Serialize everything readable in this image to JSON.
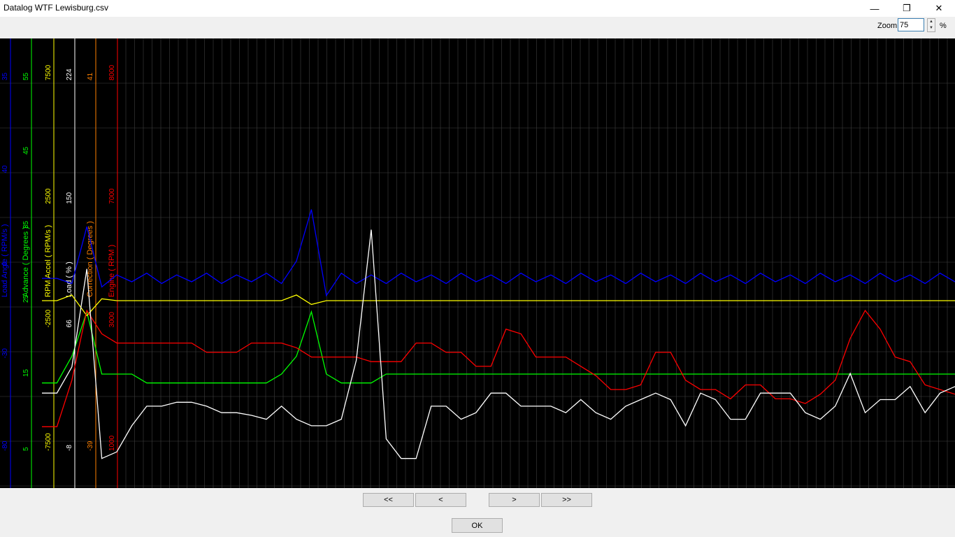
{
  "window": {
    "title": "Datalog WTF Lewisburg.csv",
    "minimize_glyph": "—",
    "restore_glyph": "❐",
    "close_glyph": "✕"
  },
  "zoom": {
    "label": "Zoom",
    "value": "75",
    "unit": "%"
  },
  "nav": {
    "first": "<<",
    "prev": "<",
    "next": ">",
    "last": ">>"
  },
  "ok_label": "OK",
  "colors": {
    "plot_bg": "#000000",
    "grid": "#404040",
    "load_angle": "#0000ff",
    "advance": "#00ff00",
    "rpm_accel": "#ffff00",
    "load": "#ffffff",
    "correction": "#ff8000",
    "engine_rpm": "#ff0000"
  },
  "chart_data": {
    "type": "line",
    "axes": [
      {
        "name": "Load Angle ( RPM/s )",
        "color": "#0000ff",
        "ticks": [
          "35",
          "40",
          "0",
          "-30",
          "-80"
        ]
      },
      {
        "name": "Advance ( Degrees )",
        "color": "#00ff00",
        "ticks": [
          "55",
          "45",
          "35",
          "25",
          "15",
          "5"
        ]
      },
      {
        "name": "RPM Accel ( RPM/s )",
        "color": "#ffff00",
        "ticks": [
          "7500",
          "2500",
          "-2500",
          "-7500"
        ]
      },
      {
        "name": "Load ( % )",
        "color": "#ffffff",
        "ticks": [
          "224",
          "150",
          "66",
          "-8"
        ]
      },
      {
        "name": "Correction ( Degrees )",
        "color": "#ff8000",
        "ticks": [
          "41",
          "-39"
        ]
      },
      {
        "name": "Engine ( RPM )",
        "color": "#ff0000",
        "ticks": [
          "8000",
          "7000",
          "3000",
          "1000"
        ]
      }
    ],
    "series": [
      {
        "name": "Engine ( RPM )",
        "values": [
          1500,
          1500,
          2500,
          4000,
          3500,
          3300,
          3300,
          3300,
          3300,
          3300,
          3300,
          3100,
          3100,
          3100,
          3300,
          3300,
          3300,
          3200,
          3000,
          3000,
          3000,
          3000,
          2900,
          2900,
          2900,
          3300,
          3300,
          3100,
          3100,
          2800,
          2800,
          3600,
          3500,
          3000,
          3000,
          3000,
          2800,
          2600,
          2300,
          2300,
          2400,
          3100,
          3100,
          2500,
          2300,
          2300,
          2100,
          2400,
          2400,
          2100,
          2100,
          2000,
          2200,
          2500,
          3400,
          4000,
          3600,
          3000,
          2900,
          2400,
          2300,
          2200
        ]
      },
      {
        "name": "Load ( % )",
        "values": [
          55,
          55,
          75,
          150,
          5,
          10,
          30,
          45,
          45,
          48,
          48,
          45,
          40,
          40,
          38,
          35,
          45,
          35,
          30,
          30,
          35,
          80,
          180,
          20,
          5,
          5,
          45,
          45,
          35,
          40,
          55,
          55,
          45,
          45,
          45,
          40,
          50,
          40,
          35,
          45,
          50,
          55,
          50,
          30,
          55,
          50,
          35,
          35,
          55,
          55,
          55,
          40,
          35,
          45,
          70,
          40,
          50,
          50,
          60,
          40,
          55,
          60
        ]
      },
      {
        "name": "Advance ( Degrees )",
        "values": [
          14,
          14,
          20,
          30,
          16,
          16,
          16,
          14,
          14,
          14,
          14,
          14,
          14,
          14,
          14,
          14,
          16,
          20,
          30,
          16,
          14,
          14,
          14,
          16,
          16,
          16,
          16,
          16,
          16,
          16,
          16,
          16,
          16,
          16,
          16,
          16,
          16,
          16,
          16,
          16,
          16,
          16,
          16,
          16,
          16,
          16,
          16,
          16,
          16,
          16,
          16,
          16,
          16,
          16,
          16,
          16,
          16,
          16,
          16,
          16,
          16,
          16
        ]
      },
      {
        "name": "RPM Accel ( RPM/s )",
        "values": [
          0,
          0,
          300,
          -800,
          100,
          0,
          0,
          0,
          0,
          0,
          0,
          0,
          0,
          0,
          0,
          0,
          0,
          300,
          -200,
          0,
          0,
          0,
          0,
          0,
          0,
          0,
          0,
          0,
          0,
          0,
          0,
          0,
          0,
          0,
          0,
          0,
          0,
          0,
          0,
          0,
          0,
          0,
          0,
          0,
          0,
          0,
          0,
          0,
          0,
          0,
          0,
          0,
          0,
          0,
          0,
          0,
          0,
          0,
          0,
          0,
          0,
          0
        ]
      },
      {
        "name": "Load Angle ( RPM/s )",
        "values": [
          0,
          0,
          -3,
          30,
          -5,
          2,
          -2,
          3,
          -3,
          2,
          -2,
          3,
          -3,
          2,
          -2,
          3,
          -3,
          10,
          40,
          -10,
          3,
          -3,
          2,
          -3,
          3,
          -2,
          2,
          -3,
          3,
          -2,
          2,
          -3,
          3,
          -2,
          2,
          -3,
          3,
          -2,
          2,
          -3,
          3,
          -2,
          2,
          -3,
          3,
          -2,
          2,
          -3,
          3,
          -2,
          2,
          -3,
          3,
          -2,
          2,
          -3,
          3,
          -2,
          2,
          -3,
          3,
          -2
        ]
      }
    ]
  }
}
